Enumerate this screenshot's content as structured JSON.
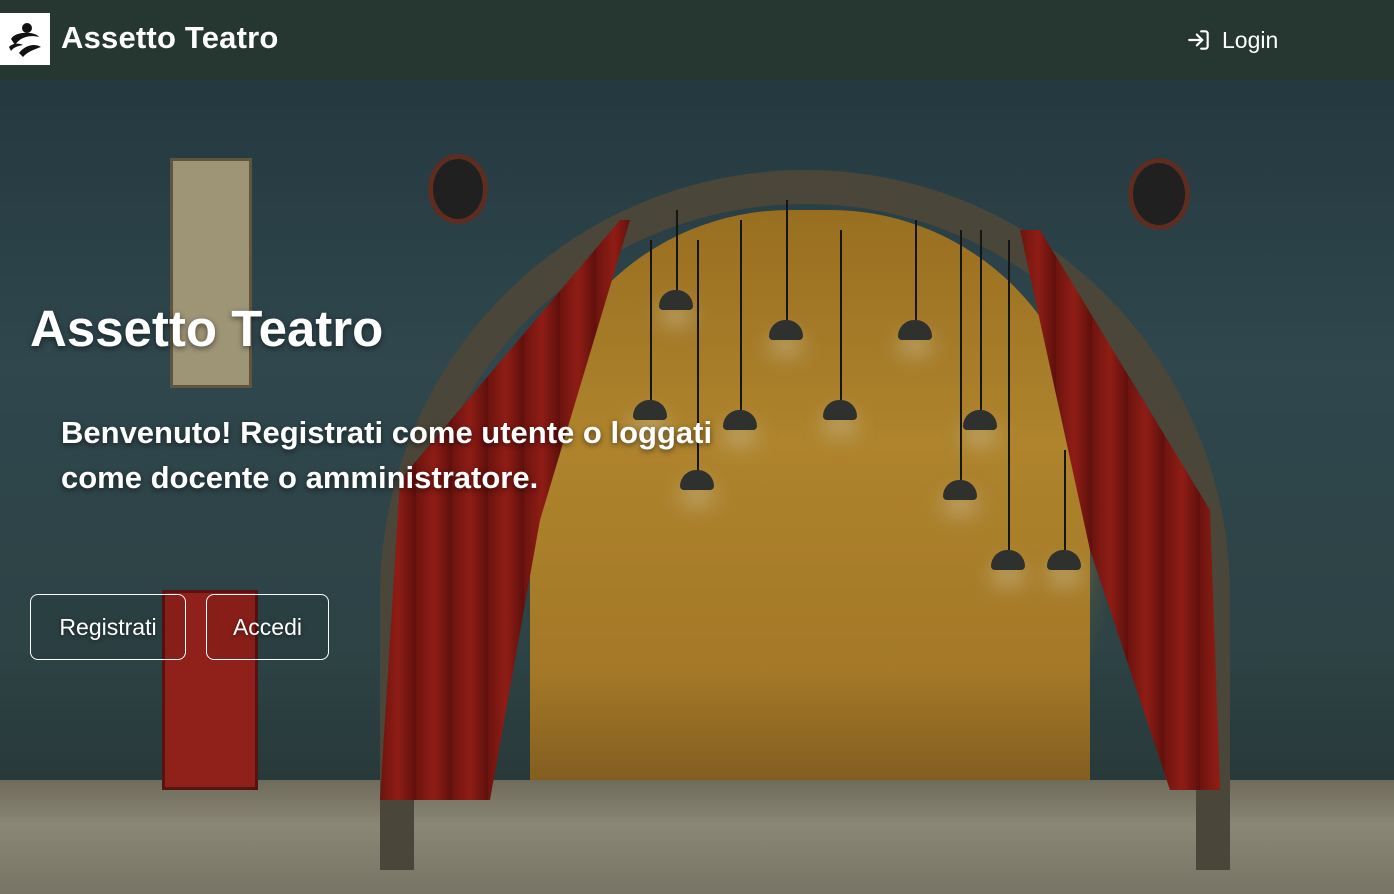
{
  "header": {
    "brand": "Assetto Teatro",
    "login_label": "Login",
    "logo_icon": "theater-logo-icon",
    "login_icon": "login-arrow-icon"
  },
  "hero": {
    "title": "Assetto Teatro",
    "message": "Benvenuto! Registrati come utente o loggati come docente o amministratore.",
    "register_label": "Registrati",
    "access_label": "Accedi"
  },
  "colors": {
    "topbar": "#263630",
    "text": "#ffffff",
    "curtain": "#b8251c",
    "stage": "#e0a93a"
  }
}
